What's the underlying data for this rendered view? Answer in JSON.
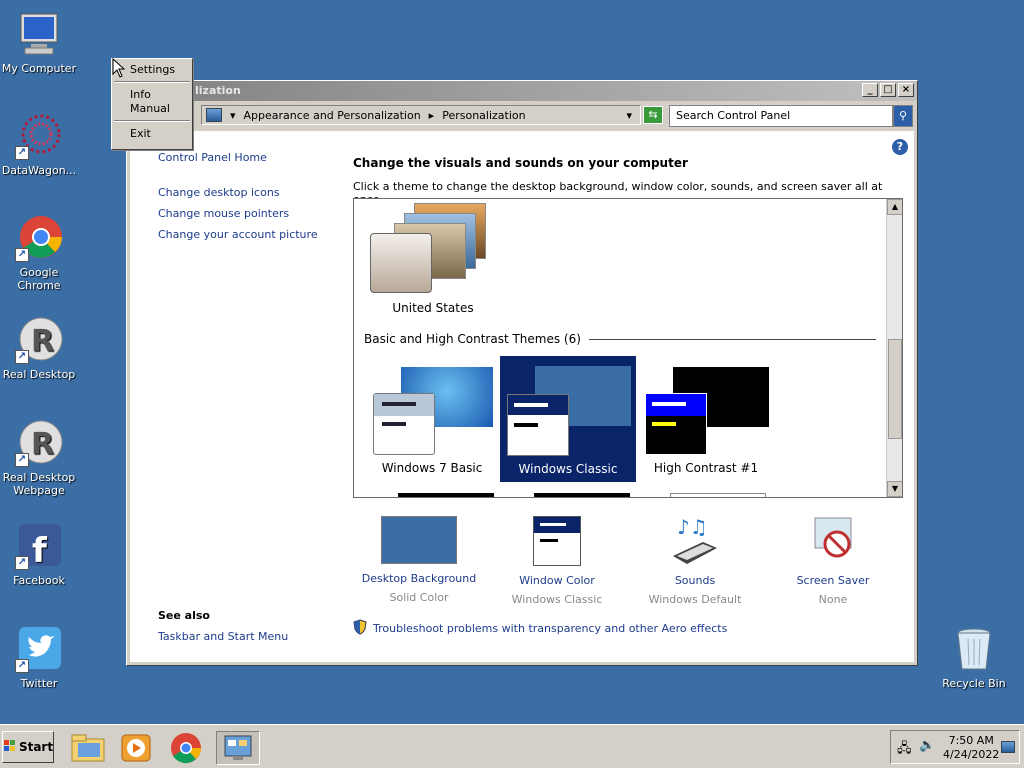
{
  "desktop": {
    "icons": [
      {
        "label": "My Computer"
      },
      {
        "label": "DataWagon..."
      },
      {
        "label": "Google Chrome"
      },
      {
        "label": "Real Desktop"
      },
      {
        "label": "Real Desktop Webpage"
      },
      {
        "label": "Facebook"
      },
      {
        "label": "Twitter"
      },
      {
        "label": "Recycle Bin"
      }
    ]
  },
  "window": {
    "title": "lization",
    "address": {
      "crumbs": [
        "Appearance and Personalization",
        "Personalization"
      ]
    },
    "search": {
      "placeholder": "Search Control Panel"
    },
    "help_glyph": "?",
    "left_links": [
      "Control Panel Home",
      "Change desktop icons",
      "Change mouse pointers",
      "Change your account picture"
    ],
    "see_also": {
      "header": "See also",
      "link": "Taskbar and Start Menu"
    },
    "main": {
      "title": "Change the visuals and sounds on your computer",
      "subtitle": "Click a theme to change the desktop background, window color, sounds, and screen saver all at once.",
      "my_theme": "United States",
      "section": "Basic and High Contrast Themes (6)",
      "themes": [
        "Windows 7 Basic",
        "Windows Classic",
        "High Contrast #1"
      ]
    },
    "bottom": [
      {
        "label": "Desktop Background",
        "value": "Solid Color"
      },
      {
        "label": "Window Color",
        "value": "Windows Classic"
      },
      {
        "label": "Sounds",
        "value": "Windows Default"
      },
      {
        "label": "Screen Saver",
        "value": "None"
      }
    ],
    "troubleshoot": "Troubleshoot problems with transparency and other Aero effects"
  },
  "context_menu": {
    "items": [
      "Settings",
      "Info",
      "Manual",
      "Exit"
    ]
  },
  "taskbar": {
    "start_label": "Start",
    "time": "7:50 AM",
    "date": "4/24/2022"
  },
  "colors": {
    "desktop": "#3b6ea5",
    "selected_theme": "#0a246a",
    "link": "#1e3c8c"
  }
}
